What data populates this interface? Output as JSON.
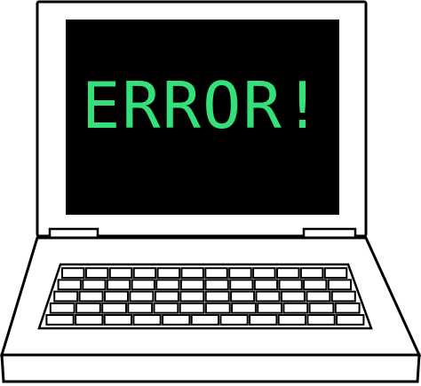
{
  "screen": {
    "message": "ERROR!"
  },
  "colors": {
    "outline": "#000000",
    "body": "#ffffff",
    "screen_background": "#000000",
    "screen_text": "#33e07a"
  },
  "keyboard": {
    "rows": 5,
    "keys_per_row": [
      12,
      12,
      12,
      12,
      11
    ]
  }
}
